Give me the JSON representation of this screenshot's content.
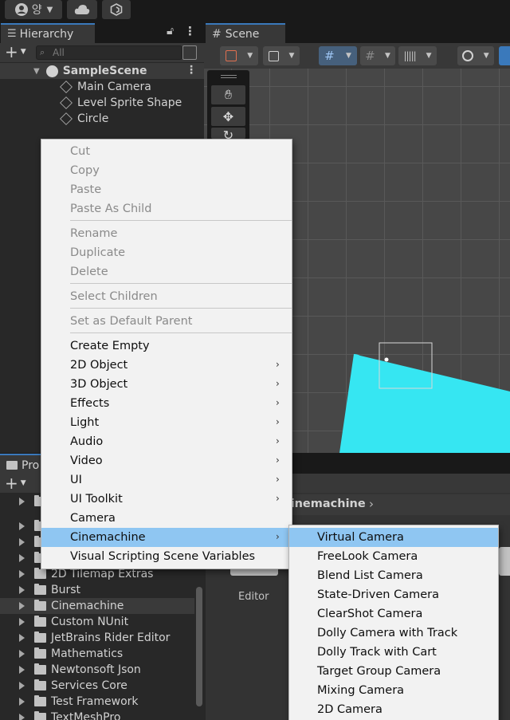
{
  "toolbar": {
    "account_label": "양",
    "icons": [
      "account-icon",
      "cloud-icon",
      "collab-icon"
    ]
  },
  "hierarchy": {
    "tab_label": "Hierarchy",
    "search_placeholder": "All",
    "scene_name": "SampleScene",
    "items": [
      {
        "label": "Main Camera"
      },
      {
        "label": "Level Sprite Shape"
      },
      {
        "label": "Circle"
      }
    ]
  },
  "scene": {
    "tab_label": "Scene",
    "shape_color": "#36e6f2",
    "grid_color": "#595959"
  },
  "project": {
    "tab_label": "Pro",
    "breadcrumb": "Cinemachine",
    "folders": [
      {
        "label": "2D Tilemap Extras",
        "selected": false
      },
      {
        "label": "Burst",
        "selected": false
      },
      {
        "label": "Cinemachine",
        "selected": true
      },
      {
        "label": "Custom NUnit",
        "selected": false
      },
      {
        "label": "JetBrains Rider Editor",
        "selected": false
      },
      {
        "label": "Mathematics",
        "selected": false
      },
      {
        "label": "Newtonsoft Json",
        "selected": false
      },
      {
        "label": "Services Core",
        "selected": false
      },
      {
        "label": "Test Framework",
        "selected": false
      },
      {
        "label": "TextMeshPro",
        "selected": false
      }
    ],
    "asset_label": "Editor"
  },
  "context_menu": {
    "groups": [
      [
        {
          "label": "Cut",
          "enabled": false
        },
        {
          "label": "Copy",
          "enabled": false
        },
        {
          "label": "Paste",
          "enabled": false
        },
        {
          "label": "Paste As Child",
          "enabled": false
        }
      ],
      [
        {
          "label": "Rename",
          "enabled": false
        },
        {
          "label": "Duplicate",
          "enabled": false
        },
        {
          "label": "Delete",
          "enabled": false
        }
      ],
      [
        {
          "label": "Select Children",
          "enabled": false
        }
      ],
      [
        {
          "label": "Set as Default Parent",
          "enabled": false
        }
      ],
      [
        {
          "label": "Create Empty",
          "enabled": true,
          "submenu": false
        },
        {
          "label": "2D Object",
          "enabled": true,
          "submenu": true
        },
        {
          "label": "3D Object",
          "enabled": true,
          "submenu": true
        },
        {
          "label": "Effects",
          "enabled": true,
          "submenu": true
        },
        {
          "label": "Light",
          "enabled": true,
          "submenu": true
        },
        {
          "label": "Audio",
          "enabled": true,
          "submenu": true
        },
        {
          "label": "Video",
          "enabled": true,
          "submenu": true
        },
        {
          "label": "UI",
          "enabled": true,
          "submenu": true
        },
        {
          "label": "UI Toolkit",
          "enabled": true,
          "submenu": true
        },
        {
          "label": "Camera",
          "enabled": true,
          "submenu": false
        },
        {
          "label": "Cinemachine",
          "enabled": true,
          "submenu": true,
          "highlighted": true
        },
        {
          "label": "Visual Scripting Scene Variables",
          "enabled": true,
          "submenu": false
        }
      ]
    ]
  },
  "cinemachine_submenu": {
    "items": [
      {
        "label": "Virtual Camera",
        "highlighted": true
      },
      {
        "label": "FreeLook Camera"
      },
      {
        "label": "Blend List Camera"
      },
      {
        "label": "State-Driven Camera"
      },
      {
        "label": "ClearShot Camera"
      },
      {
        "label": "Dolly Camera with Track"
      },
      {
        "label": "Dolly Track with Cart"
      },
      {
        "label": "Target Group Camera"
      },
      {
        "label": "Mixing Camera"
      },
      {
        "label": "2D Camera"
      }
    ]
  },
  "colors": {
    "menu_highlight": "#8fc6f2",
    "tab_accent": "#3a79bb"
  }
}
